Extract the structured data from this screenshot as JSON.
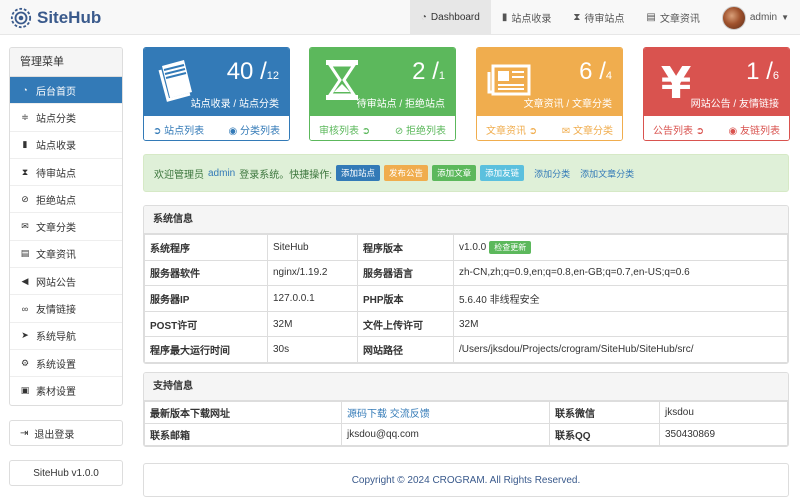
{
  "brand": {
    "name": "SiteHub"
  },
  "nav": {
    "dashboard": "Dashboard",
    "sites": "站点收录",
    "pending": "待审站点",
    "articles": "文章资讯",
    "user": "admin"
  },
  "sidebar": {
    "title": "管理菜单",
    "items": [
      {
        "label": "后台首页",
        "icon": "dashboard-icon"
      },
      {
        "label": "站点分类",
        "icon": "sliders-icon"
      },
      {
        "label": "站点收录",
        "icon": "book-icon"
      },
      {
        "label": "待审站点",
        "icon": "hourglass-icon"
      },
      {
        "label": "拒绝站点",
        "icon": "ban-icon"
      },
      {
        "label": "文章分类",
        "icon": "envelope-icon"
      },
      {
        "label": "文章资讯",
        "icon": "newspaper-icon"
      },
      {
        "label": "网站公告",
        "icon": "bullhorn-icon"
      },
      {
        "label": "友情链接",
        "icon": "handshake-icon"
      },
      {
        "label": "系统导航",
        "icon": "location-arrow-icon"
      },
      {
        "label": "系统设置",
        "icon": "gear-icon"
      },
      {
        "label": "素材设置",
        "icon": "image-icon"
      }
    ],
    "logout": "退出登录",
    "version": "SiteHub v1.0.0"
  },
  "cards": [
    {
      "big": "40",
      "small": "12",
      "caption": "站点收录 / 站点分类",
      "link1": "站点列表",
      "link2": "分类列表",
      "color": "#337ab7"
    },
    {
      "big": "2",
      "small": "1",
      "caption": "待审站点 / 拒绝站点",
      "link1": "审核列表",
      "link2": "拒绝列表",
      "color": "#5cb85c"
    },
    {
      "big": "6",
      "small": "4",
      "caption": "文章资讯 / 文章分类",
      "link1": "文章资讯",
      "link2": "文章分类",
      "color": "#f0ad4e"
    },
    {
      "big": "1",
      "small": "6",
      "caption": "网站公告 / 友情链接",
      "link1": "公告列表",
      "link2": "友链列表",
      "color": "#d9534f"
    }
  ],
  "welcome": {
    "prefix": "欢迎管理员",
    "user": "admin",
    "suffix": "登录系统。快捷操作:",
    "btn_add_site": "添加站点",
    "btn_post_notice": "发布公告",
    "btn_add_article": "添加文章",
    "btn_add_link": "添加友链",
    "lnk_add_category": "添加分类",
    "lnk_add_article_category": "添加文章分类"
  },
  "system": {
    "title": "系统信息",
    "rows": [
      {
        "k1": "系统程序",
        "v1": "SiteHub",
        "k2": "程序版本",
        "v2": "v1.0.0"
      },
      {
        "k1": "服务器软件",
        "v1": "nginx/1.19.2",
        "k2": "服务器语言",
        "v2": "zh-CN,zh;q=0.9,en;q=0.8,en-GB;q=0.7,en-US;q=0.6"
      },
      {
        "k1": "服务器IP",
        "v1": "127.0.0.1",
        "k2": "PHP版本",
        "v2": "5.6.40 非线程安全"
      },
      {
        "k1": "POST许可",
        "v1": "32M",
        "k2": "文件上传许可",
        "v2": "32M"
      },
      {
        "k1": "程序最大运行时间",
        "v1": "30s",
        "k2": "网站路径",
        "v2": "/Users/jksdou/Projects/crogram/SiteHub/SiteHub/src/"
      }
    ],
    "update_btn": "检查更新"
  },
  "support": {
    "title": "支持信息",
    "r1k1": "最新版本下载网址",
    "r1v1a": "源码下载",
    "r1v1b": "交流反馈",
    "r1k2": "联系微信",
    "r1v2": "jksdou",
    "r2k1": "联系邮箱",
    "r2v1": "jksdou@qq.com",
    "r2k2": "联系QQ",
    "r2v2": "350430869"
  },
  "footer": "Copyright © 2024 CROGRAM. All Rights Reserved."
}
